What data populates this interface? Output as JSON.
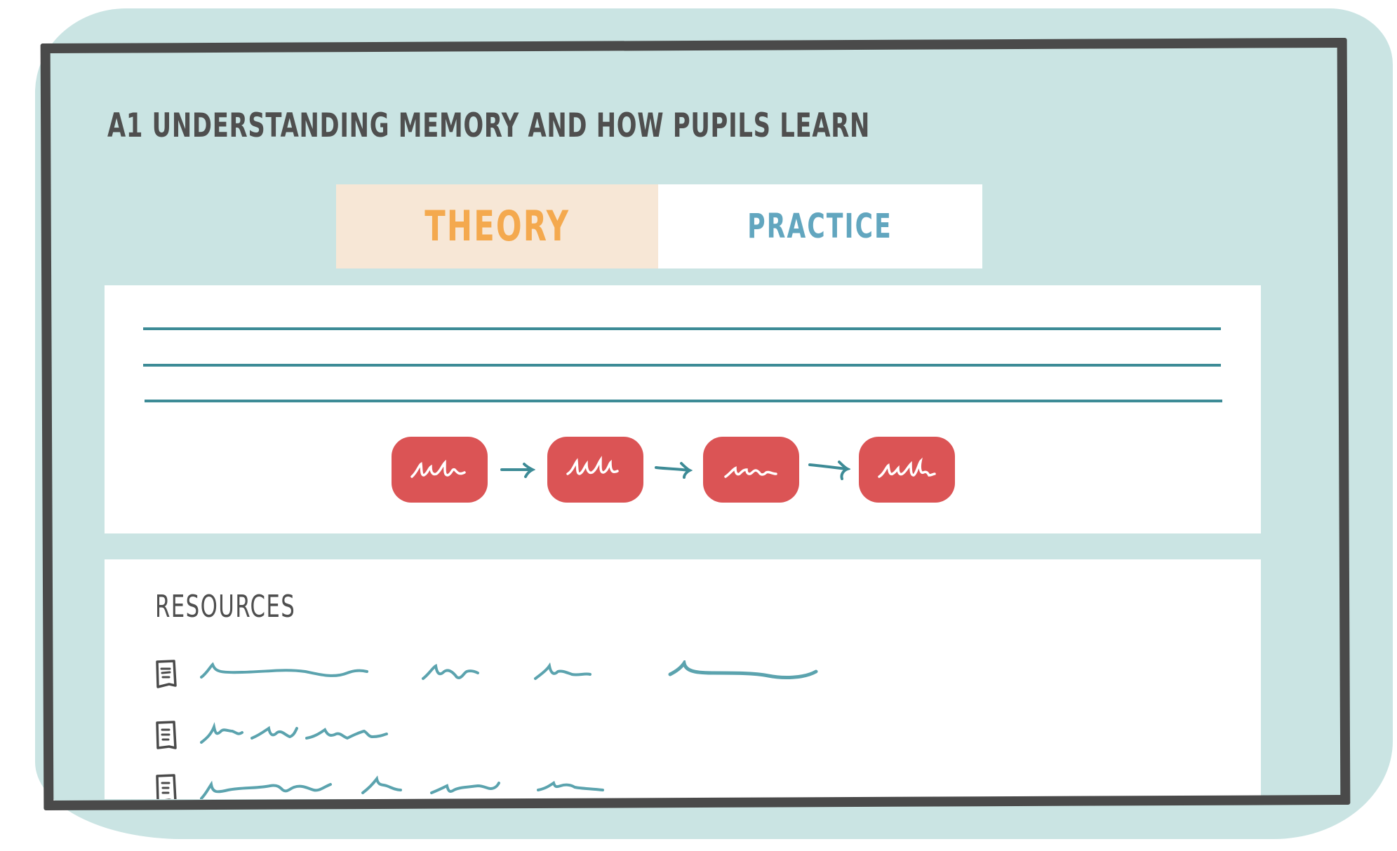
{
  "module": {
    "title": "A1 UNDERSTANDING MEMORY AND HOW PUPILS LEARN"
  },
  "tabs": [
    {
      "label": "THEORY",
      "active": true
    },
    {
      "label": "PRACTICE",
      "active": false
    }
  ],
  "theory_panel": {
    "text_lines": 3,
    "flow_steps": [
      {
        "label": "step-1",
        "icon": "scribble-text"
      },
      {
        "label": "step-2",
        "icon": "scribble-text"
      },
      {
        "label": "step-3",
        "icon": "scribble-text"
      },
      {
        "label": "step-4",
        "icon": "scribble-text"
      }
    ],
    "flow_arrows": 3
  },
  "resources": {
    "heading": "RESOURCES",
    "items": [
      {
        "icon": "document-icon",
        "placeholder": "scribbled link text"
      },
      {
        "icon": "document-icon",
        "placeholder": "scribbled link text"
      },
      {
        "icon": "document-icon",
        "placeholder": "scribbled link text"
      }
    ]
  },
  "colors": {
    "background": "#cae4e3",
    "frame": "#4a4a4a",
    "theory_tab_bg": "#f7e7d6",
    "theory_tab_text": "#f4a94e",
    "practice_tab_text": "#62a6bf",
    "rule_line": "#3d8b96",
    "flow_step": "#db5455",
    "link_scribble": "#5ba3ae"
  }
}
